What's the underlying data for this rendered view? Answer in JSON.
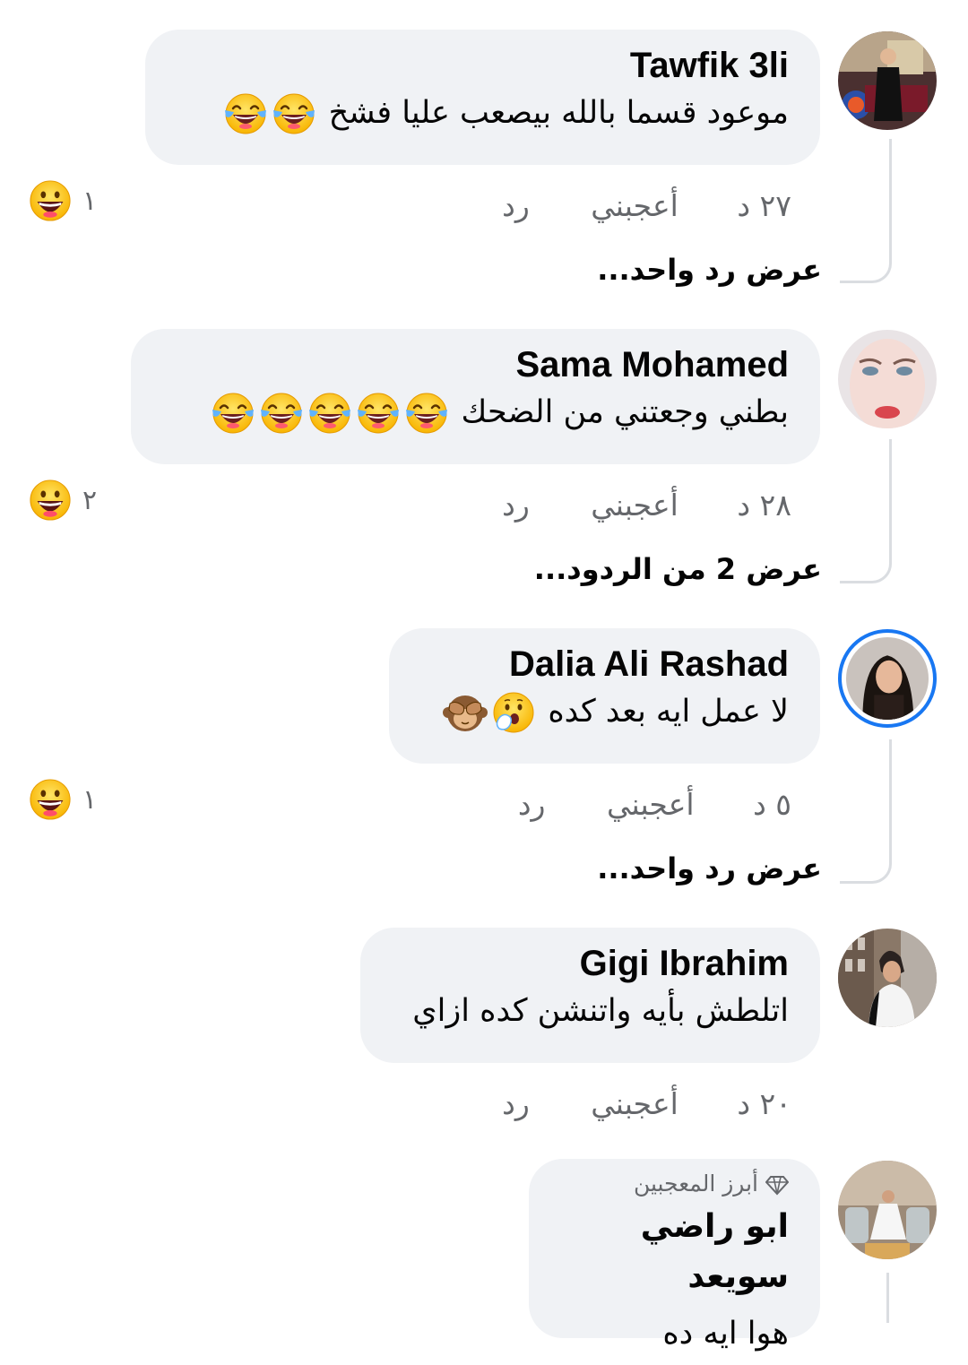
{
  "colors": {
    "bubble_bg": "#f0f2f5",
    "meta_text": "#65676b",
    "story_ring": "#1877f2",
    "thread_line": "#dadde1"
  },
  "comments": [
    {
      "author": "Tawfik 3li",
      "text": "موعود قسما بالله بيصعب عليا فشخ",
      "trailing_emojis": [
        "tears-of-joy",
        "tears-of-joy"
      ],
      "time": "٢٧ د",
      "like_label": "أعجبني",
      "reply_label": "رد",
      "reaction_count": "١",
      "view_replies": "عرض رد واحد..."
    },
    {
      "author": "Sama Mohamed",
      "text": "بطني وجعتني من الضحك",
      "trailing_emojis": [
        "tears-of-joy",
        "tears-of-joy",
        "tears-of-joy",
        "tears-of-joy",
        "tears-of-joy"
      ],
      "time": "٢٨ د",
      "like_label": "أعجبني",
      "reply_label": "رد",
      "reaction_count": "٢",
      "view_replies": "عرض 2 من الردود..."
    },
    {
      "author": "Dalia Ali Rashad",
      "text": "لا عمل ايه بعد كده",
      "trailing_emojis": [
        "face-with-hand-over-mouth",
        "see-no-evil-monkey"
      ],
      "time": "٥ د",
      "like_label": "أعجبني",
      "reply_label": "رد",
      "reaction_count": "١",
      "view_replies": "عرض رد واحد..."
    },
    {
      "author": "Gigi Ibrahim",
      "text": "اتلطش بأيه واتنشن كده ازاي",
      "time": "٢٠ د",
      "like_label": "أعجبني",
      "reply_label": "رد"
    },
    {
      "badge": "أبرز المعجبين",
      "badge_icon": "diamond-icon",
      "author": "ابو راضي سويعد",
      "text": "هوا ايه ده"
    }
  ],
  "reaction_icon": "laughing-face-icon"
}
